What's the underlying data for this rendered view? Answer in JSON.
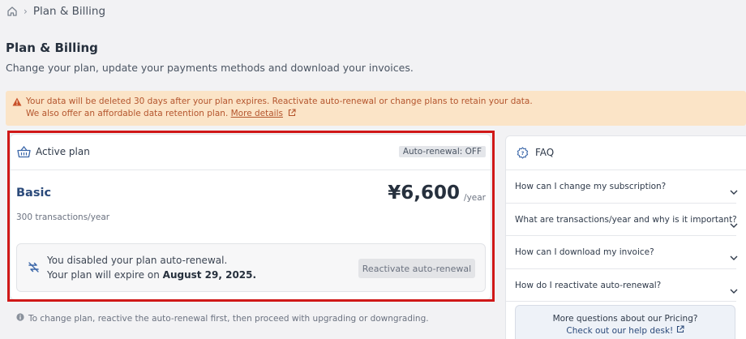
{
  "breadcrumb": {
    "home_icon": "home-icon",
    "separator": "›",
    "current": "Plan & Billing"
  },
  "page": {
    "title": "Plan & Billing",
    "subtitle": "Change your plan, update your payments methods and download your invoices."
  },
  "alert": {
    "icon": "warning-icon",
    "line1": "Your data will be deleted 30 days after your plan expires. Reactivate auto-renewal or change plans to retain your data.",
    "line2_prefix": "We also offer an affordable data retention plan.",
    "link_label": "More details",
    "color": "#b4552d",
    "background": "#fbe4c7"
  },
  "active_plan": {
    "header_label": "Active plan",
    "header_icon": "basket-icon",
    "badge": "Auto-renewal: OFF",
    "plan_name": "Basic",
    "quota": "300 transactions/year",
    "price": "¥6,600",
    "price_unit": "/year",
    "notice": {
      "icon": "renew-icon",
      "line1": "You disabled your plan auto-renewal.",
      "line2_prefix": "Your plan will expire on",
      "expiry_date": "August 29, 2025.",
      "button_label": "Reactivate auto-renewal"
    },
    "highlight_color": "#d01818"
  },
  "footnote": {
    "icon": "info-icon",
    "text": "To change plan, reactive the auto-renewal first, then proceed with upgrading or downgrading."
  },
  "faq": {
    "title": "FAQ",
    "icon": "faq-gear-icon",
    "items": [
      {
        "question": "How can I change my subscription?"
      },
      {
        "question": "What are transactions/year and why is it important?"
      },
      {
        "question": "How can I download my invoice?"
      },
      {
        "question": "How do I reactivate auto-renewal?"
      }
    ],
    "more_title": "More questions about our Pricing?",
    "more_link": "Check out our help desk!"
  }
}
